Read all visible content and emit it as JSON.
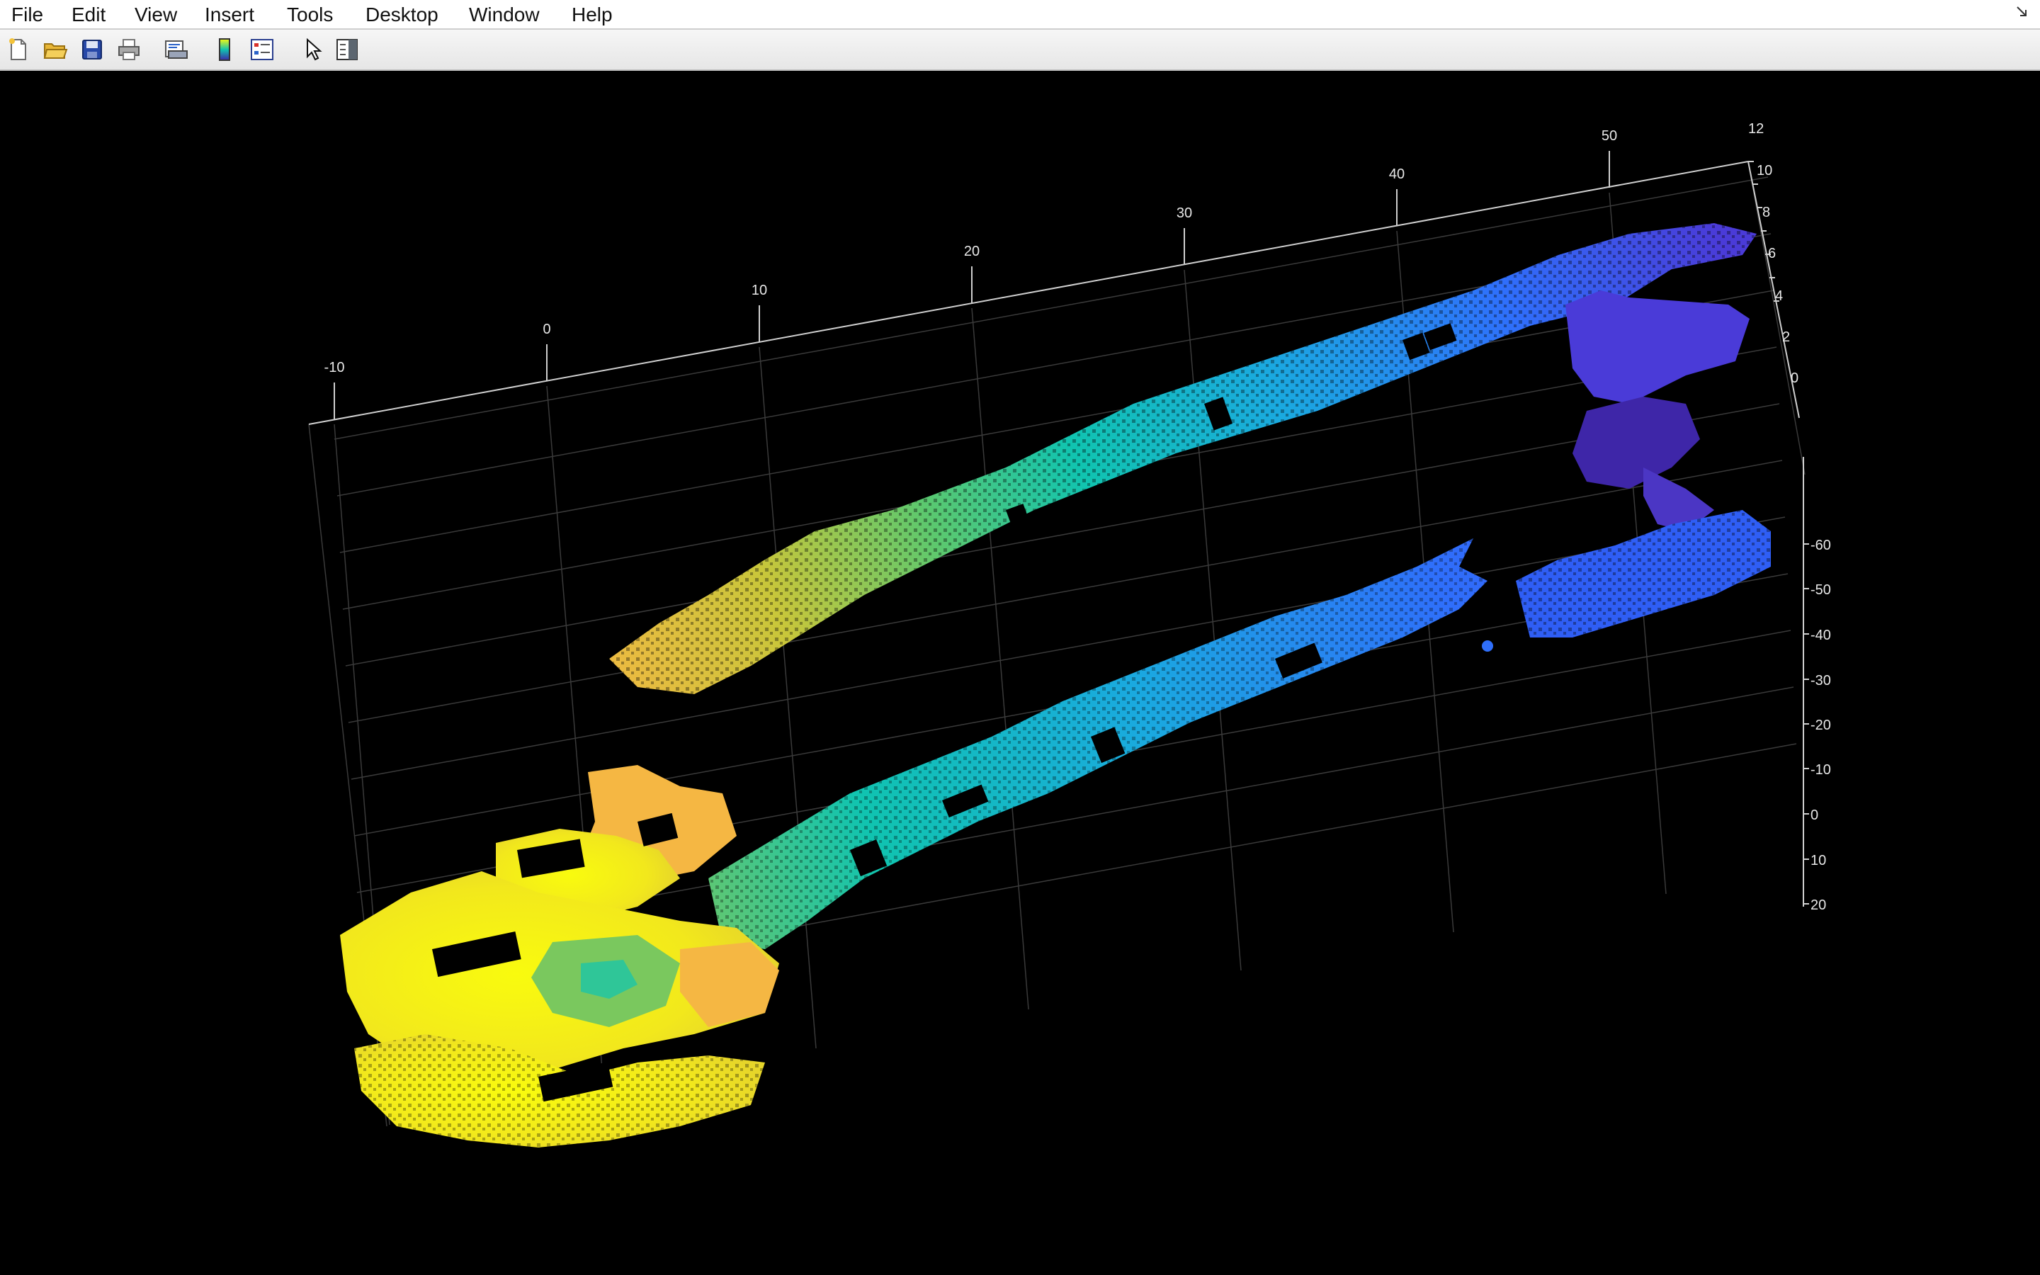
{
  "menubar": {
    "items": [
      {
        "label": "File"
      },
      {
        "label": "Edit"
      },
      {
        "label": "View"
      },
      {
        "label": "Insert"
      },
      {
        "label": "Tools"
      },
      {
        "label": "Desktop"
      },
      {
        "label": "Window"
      },
      {
        "label": "Help"
      }
    ]
  },
  "toolbar": {
    "buttons": [
      {
        "icon": "new-figure-icon"
      },
      {
        "icon": "open-file-icon"
      },
      {
        "icon": "save-icon"
      },
      {
        "icon": "print-icon"
      },
      {
        "icon": "print-preview-icon"
      },
      {
        "icon": "insert-colorbar-icon"
      },
      {
        "icon": "insert-legend-icon"
      },
      {
        "icon": "edit-plot-arrow-icon"
      },
      {
        "icon": "property-inspector-icon"
      }
    ]
  },
  "chart_data": {
    "type": "scatter",
    "description_kind": "3d-point-cloud",
    "colormap": [
      "#3e26a8",
      "#2f6ffb",
      "#1aa9e0",
      "#10c4b0",
      "#7ac85e",
      "#f5b743",
      "#f9fb0e"
    ],
    "background": "#000000",
    "grid": true,
    "x_axis": {
      "ticks": [
        "-10",
        "0",
        "10",
        "20",
        "30",
        "40",
        "50"
      ]
    },
    "z_axis": {
      "ticks": [
        "12",
        "10",
        "8",
        "6",
        "4",
        "2",
        "0"
      ]
    },
    "y_axis": {
      "ticks": [
        "-60",
        "-50",
        "-40",
        "-30",
        "-20",
        "-10",
        "0",
        "10",
        "20"
      ]
    }
  }
}
